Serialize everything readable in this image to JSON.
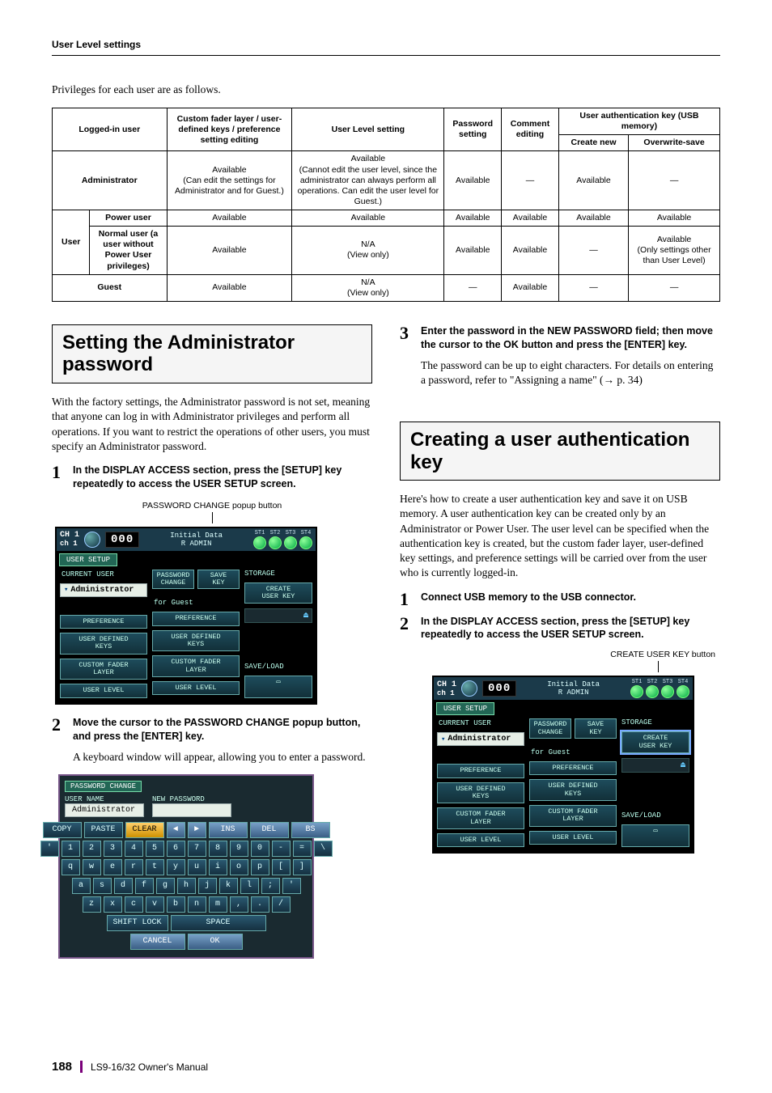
{
  "header": "User Level settings",
  "intro": "Privileges for each user are as follows.",
  "table": {
    "h_logged": "Logged-in user",
    "h_fader": "Custom fader layer / user-defined keys / preference setting editing",
    "h_level": "User Level setting",
    "h_pass": "Password setting",
    "h_comment": "Comment editing",
    "h_authkey": "User authentication key (USB memory)",
    "h_create": "Create new",
    "h_over": "Overwrite-save",
    "rows": {
      "admin": {
        "label": "Administrator",
        "fader": "Available\n(Can edit the settings for Administrator and for Guest.)",
        "level": "Available\n(Cannot edit the user level, since the administrator can always perform all operations. Can edit the user level for Guest.)",
        "pass": "Available",
        "comment": "—",
        "create": "Available",
        "over": "—"
      },
      "userhead": "User",
      "power": {
        "label": "Power user",
        "fader": "Available",
        "level": "Available",
        "pass": "Available",
        "comment": "Available",
        "create": "Available",
        "over": "Available"
      },
      "normal": {
        "label": "Normal user (a user without Power User privileges)",
        "fader": "Available",
        "level": "N/A\n(View only)",
        "pass": "Available",
        "comment": "Available",
        "create": "—",
        "over": "Available\n(Only settings other than User Level)"
      },
      "guest": {
        "label": "Guest",
        "fader": "Available",
        "level": "N/A\n(View only)",
        "pass": "—",
        "comment": "Available",
        "create": "—",
        "over": "—"
      }
    }
  },
  "sec1": {
    "title": "Setting the Administrator password",
    "p1": "With the factory settings, the Administrator password is not set, meaning that anyone can log in with Administrator privileges and perform all operations. If you want to restrict the operations of other users, you must specify an Administrator password.",
    "s1": "In the DISPLAY ACCESS section, press the [SETUP] key repeatedly to access the USER SETUP screen.",
    "cap1": "PASSWORD CHANGE popup button",
    "s2": "Move the cursor to the PASSWORD CHANGE popup button, and press the [ENTER] key.",
    "s2sub": "A keyboard window will appear, allowing you to enter a password.",
    "s3": "Enter the password in the NEW PASSWORD field; then move the cursor to the OK button and press the [ENTER] key.",
    "s3sub": "The password can be up to eight characters. For details on entering a password, refer to \"Assigning a name\" (→ p. 34)"
  },
  "sec2": {
    "title": "Creating a user authentication key",
    "p1": "Here's how to create a user authentication key and save it on USB memory. A user authentication key can be created only by an Administrator or Power User. The user level can be specified when the authentication key is created, but the custom fader layer, user-defined key settings, and preference settings will be carried over from the user who is currently logged-in.",
    "s1": "Connect USB memory to the USB connector.",
    "s2": "In the DISPLAY ACCESS section, press the [SETUP] key repeatedly to access the USER SETUP screen.",
    "cap2": "CREATE USER KEY button"
  },
  "lcd": {
    "ch_a": "CH 1",
    "ch_b": "ch 1",
    "num": "000",
    "title_a": "Initial Data",
    "title_b": "R",
    "title_c": "ADMIN",
    "st": [
      "ST1",
      "ST2",
      "ST3",
      "ST4"
    ],
    "tab": "USER SETUP",
    "current": "CURRENT USER",
    "user": "Administrator",
    "pwd": "PASSWORD\nCHANGE",
    "savekey": "SAVE\nKEY",
    "guest": "for Guest",
    "pref": "PREFERENCE",
    "udk": "USER DEFINED\nKEYS",
    "cfl": "CUSTOM FADER\nLAYER",
    "ulvl": "USER LEVEL",
    "storage": "STORAGE",
    "create": "CREATE\nUSER KEY",
    "saveload": "SAVE/LOAD"
  },
  "kbd": {
    "title": "PASSWORD CHANGE",
    "uname_l": "USER NAME",
    "uname_v": "Administrator",
    "npw_l": "NEW PASSWORD",
    "copy": "COPY",
    "paste": "PASTE",
    "clear": "CLEAR",
    "ins": "INS",
    "del": "DEL",
    "bs": "BS",
    "shift": "SHIFT LOCK",
    "space": "SPACE",
    "cancel": "CANCEL",
    "ok": "OK",
    "row1": [
      "'",
      "1",
      "2",
      "3",
      "4",
      "5",
      "6",
      "7",
      "8",
      "9",
      "0",
      "-",
      "=",
      "\\"
    ],
    "row2": [
      "q",
      "w",
      "e",
      "r",
      "t",
      "y",
      "u",
      "i",
      "o",
      "p",
      "[",
      "]"
    ],
    "row3": [
      "a",
      "s",
      "d",
      "f",
      "g",
      "h",
      "j",
      "k",
      "l",
      ";",
      "'"
    ],
    "row4": [
      "z",
      "x",
      "c",
      "v",
      "b",
      "n",
      "m",
      ",",
      ".",
      "/"
    ]
  },
  "footer": {
    "page": "188",
    "manual": "LS9-16/32  Owner's Manual"
  }
}
